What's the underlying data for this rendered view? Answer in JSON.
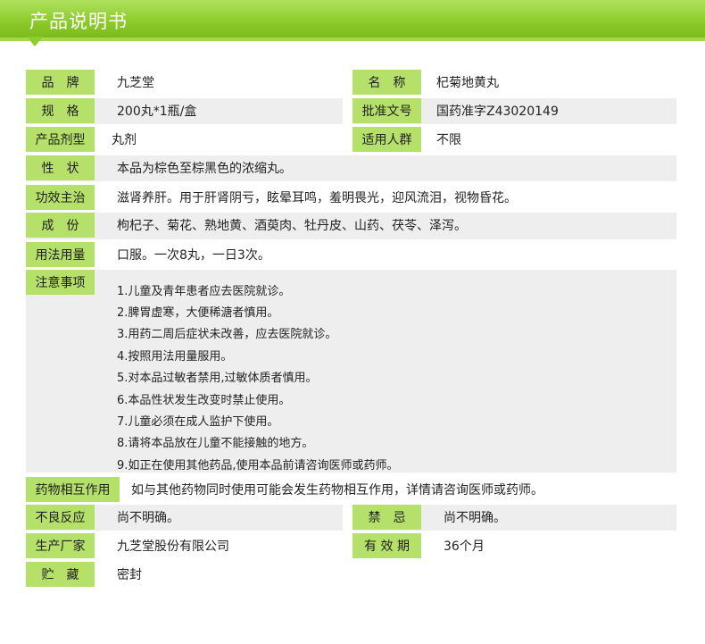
{
  "header": {
    "title": "产品说明书"
  },
  "rows": {
    "brand": {
      "label": "品　牌",
      "value": "九芝堂"
    },
    "name": {
      "label": "名　称",
      "value": "杞菊地黄丸"
    },
    "spec": {
      "label": "规　格",
      "value": "200丸*1瓶/盒"
    },
    "approval": {
      "label": "批准文号",
      "value": "国药准字Z43020149"
    },
    "dosage_form": {
      "label": "产品剂型",
      "value": "丸剂"
    },
    "target": {
      "label": "适用人群",
      "value": "不限"
    },
    "character": {
      "label": "性　状",
      "value": "本品为棕色至棕黑色的浓缩丸。"
    },
    "indication": {
      "label": "功效主治",
      "value": "滋肾养肝。用于肝肾阴亏，眩晕耳鸣，羞明畏光，迎风流泪，视物昏花。"
    },
    "ingredients": {
      "label": "成　份",
      "value": "枸杞子、菊花、熟地黄、酒萸肉、牡丹皮、山药、茯苓、泽泻。"
    },
    "usage": {
      "label": "用法用量",
      "value": "口服。一次8丸，一日3次。"
    },
    "precautions": {
      "label": "注意事项",
      "items": [
        "1.儿童及青年患者应去医院就诊。",
        "2.脾胃虚寒，大便稀溏者慎用。",
        "3.用药二周后症状未改善，应去医院就诊。",
        "4.按照用法用量服用。",
        "5.对本品过敏者禁用,过敏体质者慎用。",
        "6.本品性状发生改变时禁止使用。",
        "7.儿童必须在成人监护下使用。",
        "8.请将本品放在儿童不能接触的地方。",
        "9.如正在使用其他药品,使用本品前请咨询医师或药师。"
      ]
    },
    "interaction": {
      "label": "药物相互作用",
      "value": "如与其他药物同时使用可能会发生药物相互作用，详情请咨询医师或药师。"
    },
    "adverse": {
      "label": "不良反应",
      "value": "尚不明确。"
    },
    "contraindication": {
      "label": "禁　忌",
      "value": "尚不明确。"
    },
    "manufacturer": {
      "label": "生产厂家",
      "value": "九芝堂股份有限公司"
    },
    "validity": {
      "label": "有 效 期",
      "value": "36个月"
    },
    "storage": {
      "label": "贮　藏",
      "value": "密封"
    }
  },
  "colors": {
    "banner": "#8fcc2e",
    "label_bg": "#b5e06a",
    "row_bg": "#eeeeee"
  }
}
